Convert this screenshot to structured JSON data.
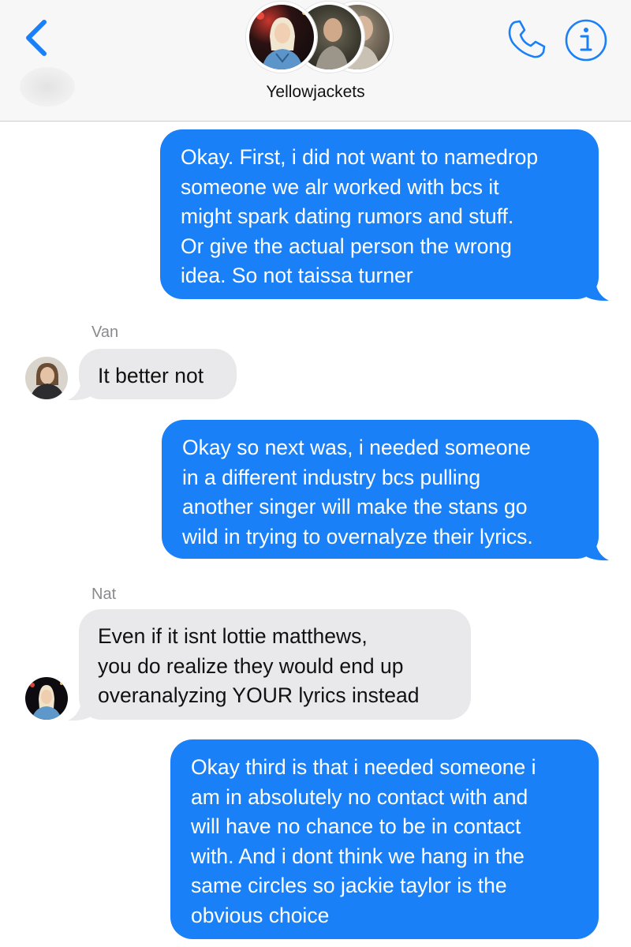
{
  "header": {
    "chat_title": "Yellowjackets",
    "back_icon": "chevron-left-icon",
    "call_icon": "phone-icon",
    "info_icon": "info-icon",
    "accent_color": "#1a80f8"
  },
  "messages": [
    {
      "direction": "outgoing",
      "lines": [
        "Okay. First, i did not want to namedrop",
        "someone we alr worked with bcs it",
        "might spark dating rumors and stuff.",
        "Or give the actual person the wrong",
        "idea. So not taissa turner"
      ]
    },
    {
      "direction": "incoming",
      "sender": "Van",
      "lines": [
        "It better not"
      ]
    },
    {
      "direction": "outgoing",
      "lines": [
        "Okay so next was, i needed someone",
        "in a different industry bcs pulling",
        "another singer will make the stans go",
        "wild in trying to overnalyze their lyrics."
      ]
    },
    {
      "direction": "incoming",
      "sender": "Nat",
      "lines": [
        "Even if it isnt lottie matthews,",
        "you do realize they would end up",
        "overanalyzing YOUR lyrics instead"
      ]
    },
    {
      "direction": "outgoing",
      "lines": [
        "Okay third is that i needed someone i",
        "am in absolutely no contact with and",
        "will have no chance to be in contact",
        "with. And i dont think we hang in the",
        "same circles so jackie taylor is the",
        "obvious choice"
      ]
    }
  ]
}
